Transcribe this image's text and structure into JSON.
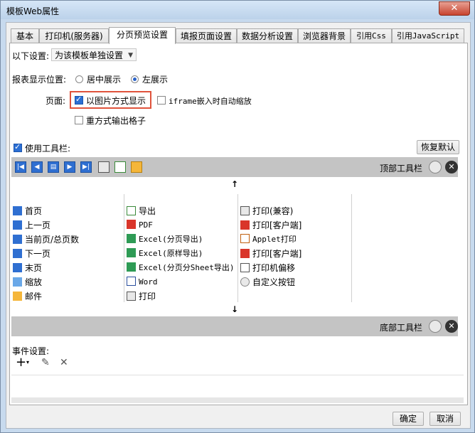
{
  "window": {
    "title": "模板Web属性",
    "close_glyph": "✕"
  },
  "tabs": [
    "基本",
    "打印机(服务器)",
    "分页预览设置",
    "填报页面设置",
    "数据分析设置",
    "浏览器背景",
    "引用Css",
    "引用JavaScript"
  ],
  "settings": {
    "scope_label": "以下设置:",
    "scope_value": "为该模板单独设置",
    "position_label": "报表显示位置:",
    "position_center": "居中展示",
    "position_left": "左展示",
    "page_label": "页面:",
    "image_mode": "以图片方式显示",
    "iframe_zoom": "iframe嵌入时自动缩放",
    "grid_output": "重方式输出格子",
    "use_toolbar": "使用工具栏:",
    "restore_default": "恢复默认"
  },
  "toolbar": {
    "top_label": "顶部工具栏",
    "bottom_label": "底部工具栏",
    "up_arrow": "↑",
    "down_arrow": "↓"
  },
  "buttons_col1": [
    "首页",
    "上一页",
    "当前页/总页数",
    "下一页",
    "末页",
    "缩放",
    "邮件"
  ],
  "buttons_col2": [
    "导出",
    "PDF",
    "Excel(分页导出)",
    "Excel(原样导出)",
    "Excel(分页分Sheet导出)",
    "Word",
    "打印"
  ],
  "buttons_col3": [
    "打印(兼容)",
    "打印[客户端]",
    "Applet打印",
    "打印[客户端]",
    "打印机偏移",
    "自定义按钮"
  ],
  "events": {
    "label": "事件设置:",
    "add": "+",
    "add_caret": "▾",
    "edit": "✎",
    "delete": "✕"
  },
  "footer": {
    "ok": "确定",
    "cancel": "取消"
  },
  "colors": {
    "accent": "#2b6fd4",
    "highlight": "#e0533c",
    "bar": "#c4c4c4"
  }
}
